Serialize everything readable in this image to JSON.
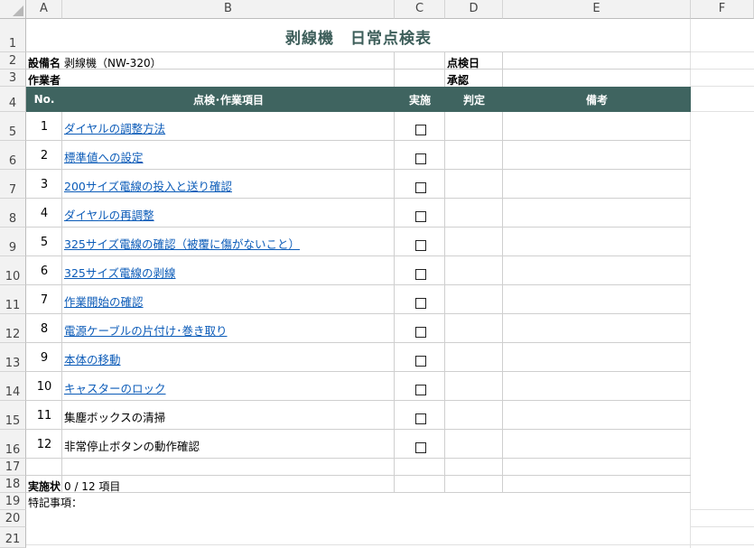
{
  "columns": [
    "A",
    "B",
    "C",
    "D",
    "E",
    "F"
  ],
  "rows": [
    "1",
    "2",
    "3",
    "4",
    "5",
    "6",
    "7",
    "8",
    "9",
    "10",
    "11",
    "12",
    "13",
    "14",
    "15",
    "16",
    "17",
    "18",
    "19",
    "20",
    "21"
  ],
  "title": "剥線機　日常点検表",
  "info": {
    "equipment_label": "設備名",
    "equipment_value": "剥線機（NW-320）",
    "inspection_date_label": "点検日",
    "worker_label": "作業者",
    "approval_label": "承認"
  },
  "table_header": {
    "no": "No.",
    "item": "点検･作業項目",
    "done": "実施",
    "judge": "判定",
    "remarks": "備考"
  },
  "items": [
    {
      "no": "1",
      "text": "ダイヤルの調整方法",
      "link": true
    },
    {
      "no": "2",
      "text": "標準値への設定",
      "link": true
    },
    {
      "no": "3",
      "text": "200サイズ電線の投入と送り確認",
      "link": true
    },
    {
      "no": "4",
      "text": "ダイヤルの再調整",
      "link": true
    },
    {
      "no": "5",
      "text": "325サイズ電線の確認（被覆に傷がないこと）",
      "link": true
    },
    {
      "no": "6",
      "text": "325サイズ電線の剥線",
      "link": true
    },
    {
      "no": "7",
      "text": "作業開始の確認",
      "link": true
    },
    {
      "no": "8",
      "text": "電源ケーブルの片付け･巻き取り",
      "link": true
    },
    {
      "no": "9",
      "text": "本体の移動",
      "link": true
    },
    {
      "no": "10",
      "text": "キャスターのロック",
      "link": true
    },
    {
      "no": "11",
      "text": "集塵ボックスの清掃",
      "link": false
    },
    {
      "no": "12",
      "text": "非常停止ボタンの動作確認",
      "link": false
    }
  ],
  "status": {
    "label": "実施状",
    "value": "0 / 12 項目"
  },
  "notes_label": "特記事項："
}
